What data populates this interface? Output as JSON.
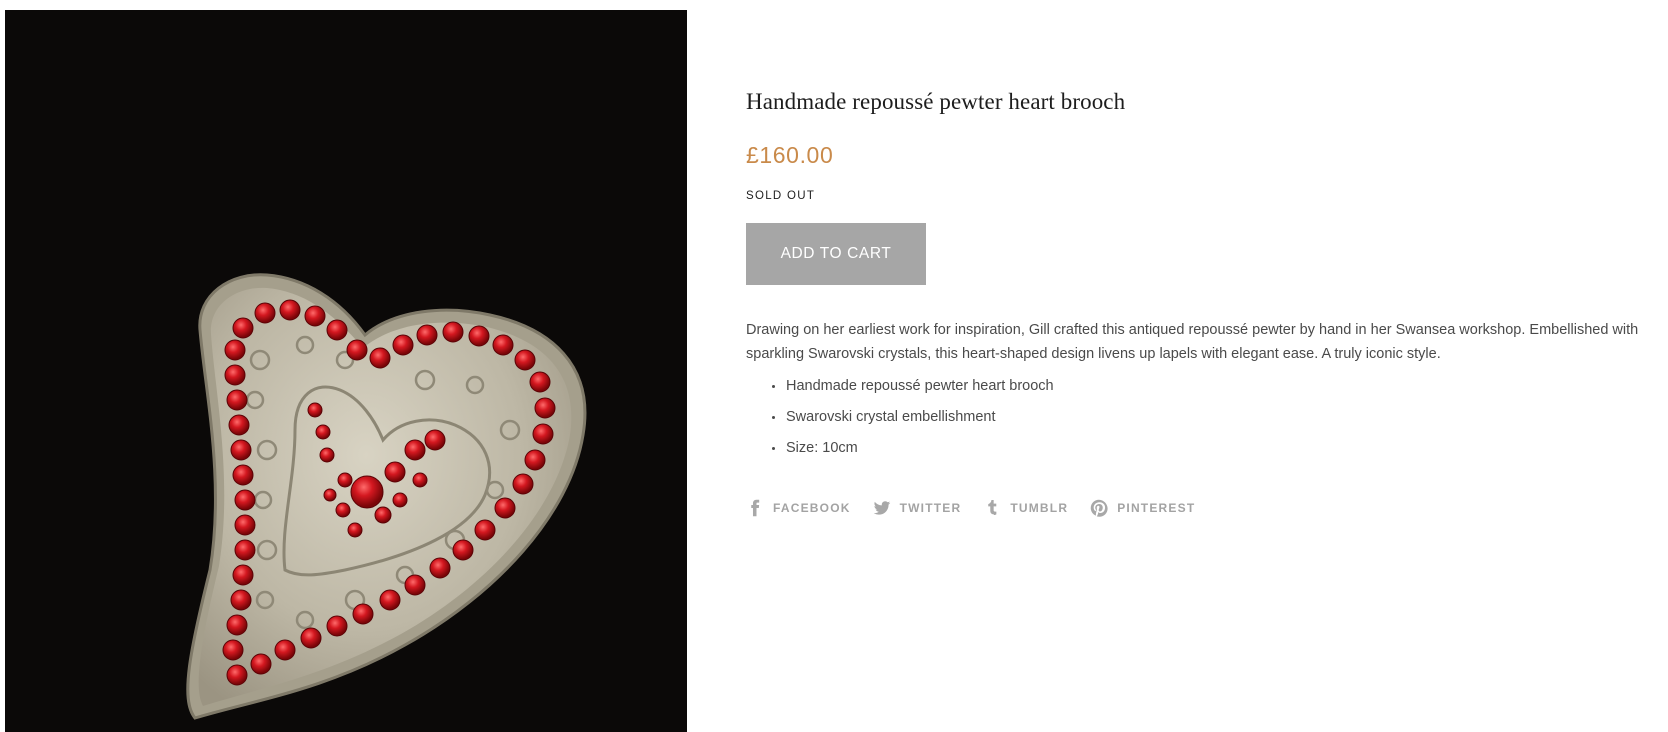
{
  "product": {
    "title": "Handmade repoussé pewter heart brooch",
    "price": "£160.00",
    "status": "SOLD OUT",
    "add_to_cart_label": "ADD TO CART",
    "description": "Drawing on her earliest work for inspiration, Gill crafted this antiqued repoussé pewter by hand in her Swansea workshop. Embellished with sparkling Swarovski crystals, this heart-shaped design livens up lapels with elegant ease. A truly iconic style.",
    "features": [
      "Handmade repoussé pewter heart brooch",
      "Swarovski crystal embellishment",
      "Size: 10cm"
    ]
  },
  "share": {
    "facebook": "FACEBOOK",
    "twitter": "TWITTER",
    "tumblr": "TUMBLR",
    "pinterest": "PINTEREST"
  },
  "colors": {
    "price": "#c98a4a",
    "button_bg": "#a6a6a6",
    "image_bg": "#0b0908",
    "crystal": "#c8161d",
    "pewter": "#c9c4b4"
  }
}
